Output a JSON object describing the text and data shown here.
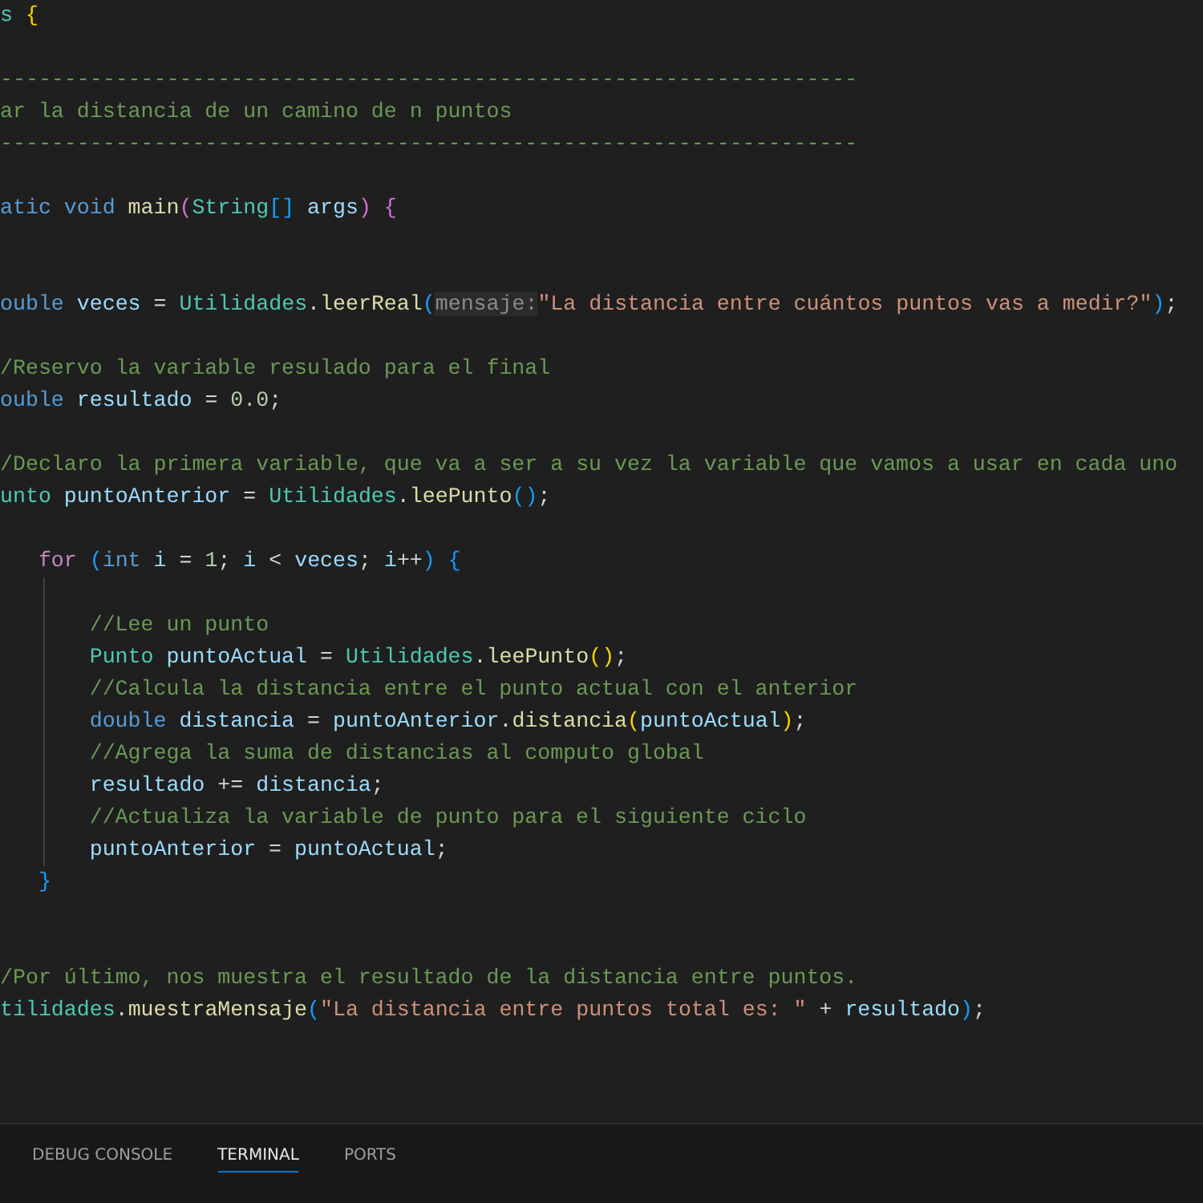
{
  "editor": {
    "lines": [
      {
        "tokens": [
          {
            "kind": "type",
            "text": "s "
          },
          {
            "kind": "bracket1",
            "text": "{"
          }
        ]
      },
      {
        "kind": "blank"
      },
      {
        "tokens": [
          {
            "kind": "comment",
            "text": "-------------------------------------------------------------------"
          }
        ]
      },
      {
        "tokens": [
          {
            "kind": "comment",
            "text": "ar la distancia de un camino de n puntos"
          }
        ]
      },
      {
        "tokens": [
          {
            "kind": "comment",
            "text": "-------------------------------------------------------------------"
          }
        ]
      },
      {
        "kind": "blank"
      },
      {
        "tokens": [
          {
            "kind": "keyword",
            "text": "atic void "
          },
          {
            "kind": "function",
            "text": "main"
          },
          {
            "kind": "bracket2",
            "text": "("
          },
          {
            "kind": "type",
            "text": "String"
          },
          {
            "kind": "bracket3",
            "text": "[] "
          },
          {
            "kind": "variable",
            "text": "args"
          },
          {
            "kind": "bracket2",
            "text": ") {"
          }
        ]
      },
      {
        "kind": "blank"
      },
      {
        "kind": "blank"
      },
      {
        "tokens": [
          {
            "kind": "keyword",
            "text": "ouble "
          },
          {
            "kind": "variable",
            "text": "veces"
          },
          {
            "kind": "plain",
            "text": " = "
          },
          {
            "kind": "type",
            "text": "Utilidades"
          },
          {
            "kind": "plain",
            "text": "."
          },
          {
            "kind": "function",
            "text": "leerReal"
          },
          {
            "kind": "bracket3",
            "text": "("
          },
          {
            "kind": "hint",
            "text": "mensaje:"
          },
          {
            "kind": "string",
            "text": "\"La distancia entre cuántos puntos vas a medir?\""
          },
          {
            "kind": "bracket3",
            "text": ")"
          },
          {
            "kind": "plain",
            "text": ";"
          }
        ]
      },
      {
        "kind": "blank"
      },
      {
        "tokens": [
          {
            "kind": "comment",
            "text": "/Reservo la variable resulado para el final"
          }
        ]
      },
      {
        "tokens": [
          {
            "kind": "keyword",
            "text": "ouble "
          },
          {
            "kind": "variable",
            "text": "resultado"
          },
          {
            "kind": "plain",
            "text": " = "
          },
          {
            "kind": "number",
            "text": "0.0"
          },
          {
            "kind": "plain",
            "text": ";"
          }
        ]
      },
      {
        "kind": "blank"
      },
      {
        "tokens": [
          {
            "kind": "comment",
            "text": "/Declaro la primera variable, que va a ser a su vez la variable que vamos a usar en cada uno"
          }
        ]
      },
      {
        "tokens": [
          {
            "kind": "type",
            "text": "unto "
          },
          {
            "kind": "variable",
            "text": "puntoAnterior"
          },
          {
            "kind": "plain",
            "text": " = "
          },
          {
            "kind": "type",
            "text": "Utilidades"
          },
          {
            "kind": "plain",
            "text": "."
          },
          {
            "kind": "function",
            "text": "leePunto"
          },
          {
            "kind": "bracket3",
            "text": "()"
          },
          {
            "kind": "plain",
            "text": ";"
          }
        ]
      },
      {
        "kind": "blank"
      },
      {
        "kind": "block",
        "header": [
          {
            "kind": "control",
            "text": "for "
          },
          {
            "kind": "bracket3",
            "text": "("
          },
          {
            "kind": "keyword",
            "text": "int "
          },
          {
            "kind": "variable",
            "text": "i"
          },
          {
            "kind": "plain",
            "text": " = "
          },
          {
            "kind": "number",
            "text": "1"
          },
          {
            "kind": "plain",
            "text": "; "
          },
          {
            "kind": "variable",
            "text": "i"
          },
          {
            "kind": "plain",
            "text": " < "
          },
          {
            "kind": "variable",
            "text": "veces"
          },
          {
            "kind": "plain",
            "text": "; "
          },
          {
            "kind": "variable",
            "text": "i"
          },
          {
            "kind": "plain",
            "text": "++"
          },
          {
            "kind": "bracket3",
            "text": ") {"
          }
        ],
        "children": [
          {
            "kind": "blank"
          },
          {
            "tokens": [
              {
                "kind": "comment",
                "text": "//Lee un punto"
              }
            ]
          },
          {
            "tokens": [
              {
                "kind": "type",
                "text": "Punto "
              },
              {
                "kind": "variable",
                "text": "puntoActual"
              },
              {
                "kind": "plain",
                "text": " = "
              },
              {
                "kind": "type",
                "text": "Utilidades"
              },
              {
                "kind": "plain",
                "text": "."
              },
              {
                "kind": "function",
                "text": "leePunto"
              },
              {
                "kind": "bracket1",
                "text": "()"
              },
              {
                "kind": "plain",
                "text": ";"
              }
            ]
          },
          {
            "tokens": [
              {
                "kind": "comment",
                "text": "//Calcula la distancia entre el punto actual con el anterior"
              }
            ]
          },
          {
            "tokens": [
              {
                "kind": "keyword",
                "text": "double "
              },
              {
                "kind": "variable",
                "text": "distancia"
              },
              {
                "kind": "plain",
                "text": " = "
              },
              {
                "kind": "variable",
                "text": "puntoAnterior"
              },
              {
                "kind": "plain",
                "text": "."
              },
              {
                "kind": "function",
                "text": "distancia"
              },
              {
                "kind": "bracket1",
                "text": "("
              },
              {
                "kind": "variable",
                "text": "puntoActual"
              },
              {
                "kind": "bracket1",
                "text": ")"
              },
              {
                "kind": "plain",
                "text": ";"
              }
            ]
          },
          {
            "tokens": [
              {
                "kind": "comment",
                "text": "//Agrega la suma de distancias al computo global"
              }
            ]
          },
          {
            "tokens": [
              {
                "kind": "variable",
                "text": "resultado"
              },
              {
                "kind": "plain",
                "text": " += "
              },
              {
                "kind": "variable",
                "text": "distancia"
              },
              {
                "kind": "plain",
                "text": ";"
              }
            ]
          },
          {
            "tokens": [
              {
                "kind": "comment",
                "text": "//Actualiza la variable de punto para el siguiente ciclo"
              }
            ]
          },
          {
            "tokens": [
              {
                "kind": "variable",
                "text": "puntoAnterior"
              },
              {
                "kind": "plain",
                "text": " = "
              },
              {
                "kind": "variable",
                "text": "puntoActual"
              },
              {
                "kind": "plain",
                "text": ";"
              }
            ]
          }
        ],
        "footer": [
          {
            "kind": "bracket3",
            "text": "}"
          }
        ]
      },
      {
        "kind": "blank"
      },
      {
        "kind": "blank"
      },
      {
        "tokens": [
          {
            "kind": "comment",
            "text": "/Por último, nos muestra el resultado de la distancia entre puntos."
          }
        ]
      },
      {
        "tokens": [
          {
            "kind": "type",
            "text": "tilidades"
          },
          {
            "kind": "plain",
            "text": "."
          },
          {
            "kind": "function",
            "text": "muestraMensaje"
          },
          {
            "kind": "bracket3",
            "text": "("
          },
          {
            "kind": "string",
            "text": "\"La distancia entre puntos total es: \""
          },
          {
            "kind": "plain",
            "text": " + "
          },
          {
            "kind": "variable",
            "text": "resultado"
          },
          {
            "kind": "bracket3",
            "text": ")"
          },
          {
            "kind": "plain",
            "text": ";"
          }
        ]
      }
    ]
  },
  "panel": {
    "tabs": [
      {
        "label": "DEBUG CONSOLE",
        "selected": false
      },
      {
        "label": "TERMINAL",
        "selected": true
      },
      {
        "label": "PORTS",
        "selected": false
      }
    ]
  }
}
